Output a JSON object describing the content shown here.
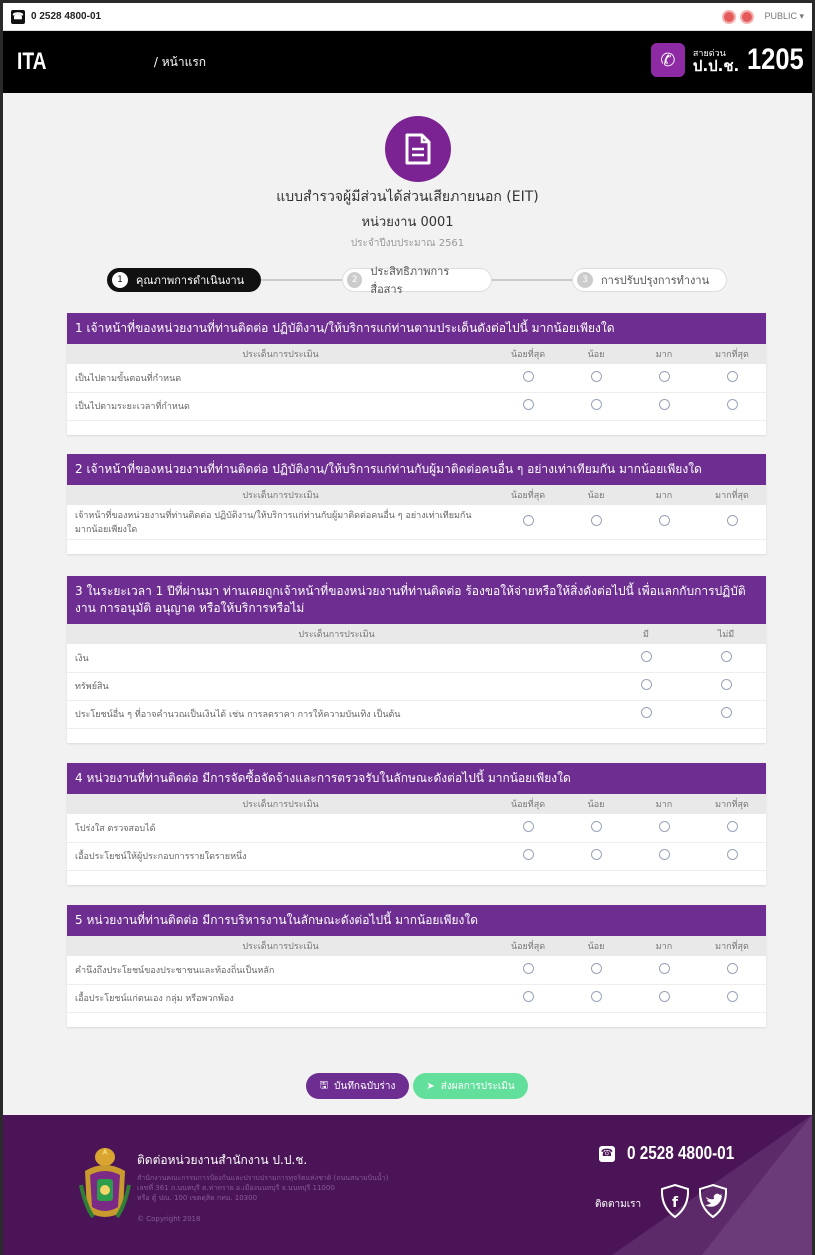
{
  "topbar": {
    "phone": "0 2528 4800-01",
    "account": "PUBLIC ▾"
  },
  "nav": {
    "brand": "ITA",
    "breadcrumb": "/ หน้าแรก",
    "hotline_small": "สายด่วน",
    "hotline_org": "ป.ป.ช.",
    "hotline_number": "1205"
  },
  "header": {
    "title": "แบบสำรวจผู้มีส่วนได้ส่วนเสียภายนอก (EIT)",
    "unit": "หน่วยงาน 0001",
    "year": "ประจำปีงบประมาณ 2561"
  },
  "steps": [
    {
      "num": "1",
      "label": "คุณภาพการดำเนินงาน"
    },
    {
      "num": "2",
      "label": "ประสิทธิภาพการสื่อสาร"
    },
    {
      "num": "3",
      "label": "การปรับปรุงการทำงาน"
    }
  ],
  "q1": {
    "title": "1 เจ้าหน้าที่ของหน่วยงานที่ท่านติดต่อ ปฏิบัติงาน/ให้บริการแก่ท่านตามประเด็นดังต่อไปนี้ มากน้อยเพียงใด",
    "col_topic": "ประเด็นการประเมิน",
    "cols": [
      "น้อยที่สุด",
      "น้อย",
      "มาก",
      "มากที่สุด"
    ],
    "rows": [
      "เป็นไปตามขั้นตอนที่กำหนด",
      "เป็นไปตามระยะเวลาที่กำหนด"
    ]
  },
  "q2": {
    "title": "2 เจ้าหน้าที่ของหน่วยงานที่ท่านติดต่อ ปฏิบัติงาน/ให้บริการแก่ท่านกับผู้มาติดต่อคนอื่น ๆ อย่างเท่าเทียมกัน มากน้อยเพียงใด",
    "col_topic": "ประเด็นการประเมิน",
    "cols": [
      "น้อยที่สุด",
      "น้อย",
      "มาก",
      "มากที่สุด"
    ],
    "rows": [
      "เจ้าหน้าที่ของหน่วยงานที่ท่านติดต่อ ปฏิบัติงาน/ให้บริการแก่ท่านกับผู้มาติดต่อคนอื่น ๆ อย่างเท่าเทียมกัน มากน้อยเพียงใด"
    ]
  },
  "q3": {
    "title": "3 ในระยะเวลา 1 ปีที่ผ่านมา ท่านเคยถูกเจ้าหน้าที่ของหน่วยงานที่ท่านติดต่อ ร้องขอให้จ่ายหรือให้สิ่งดังต่อไปนี้ เพื่อแลกกับการปฏิบัติงาน การอนุมัติ อนุญาต หรือให้บริการหรือไม่",
    "col_topic": "ประเด็นการประเมิน",
    "cols": [
      "มี",
      "ไม่มี"
    ],
    "rows": [
      "เงิน",
      "ทรัพย์สิน",
      "ประโยชน์อื่น ๆ ที่อาจคำนวณเป็นเงินได้ เช่น การลดราคา การให้ความบันเทิง เป็นต้น"
    ]
  },
  "q4": {
    "title": "4 หน่วยงานที่ท่านติดต่อ มีการจัดซื้อจัดจ้างและการตรวจรับในลักษณะดังต่อไปนี้ มากน้อยเพียงใด",
    "col_topic": "ประเด็นการประเมิน",
    "cols": [
      "น้อยที่สุด",
      "น้อย",
      "มาก",
      "มากที่สุด"
    ],
    "rows": [
      "โปร่งใส ตรวจสอบได้",
      "เอื้อประโยชน์ให้ผู้ประกอบการรายใดรายหนึ่ง"
    ]
  },
  "q5": {
    "title": "5 หน่วยงานที่ท่านติดต่อ มีการบริหารงานในลักษณะดังต่อไปนี้ มากน้อยเพียงใด",
    "col_topic": "ประเด็นการประเมิน",
    "cols": [
      "น้อยที่สุด",
      "น้อย",
      "มาก",
      "มากที่สุด"
    ],
    "rows": [
      "คำนึงถึงประโยชน์ของประชาชนและท้องถิ่นเป็นหลัก",
      "เอื้อประโยชน์แก่ตนเอง กลุ่ม หรือพวกพ้อง"
    ]
  },
  "buttons": {
    "draft": "บันทึกฉบับร่าง",
    "send": "ส่งผลการประเมิน"
  },
  "footer": {
    "title": "ติดต่อหน่วยงานสำนักงาน ป.ป.ช.",
    "addr1": "สำนักงานคณะกรรมการป้องกันและปราบปรามการทุจริตแห่งชาติ (ถนนสนามบินน้ำ)",
    "addr2": "เลขที่ 361 ถ.นนทบุรี ต.ท่าทราย อ.เมืองนนทบุรี จ.นนทบุรี 11000",
    "addr3": "หรือ ตู้ ปณ. 100 เขตดุสิต กทม. 10300",
    "copyright": "© Copyright 2018",
    "phone": "0 2528 4800-01",
    "follow": "ติดตามเรา"
  },
  "colors": {
    "purple": "#6d2d91",
    "green": "#62df9b",
    "footer": "#4a1456"
  }
}
